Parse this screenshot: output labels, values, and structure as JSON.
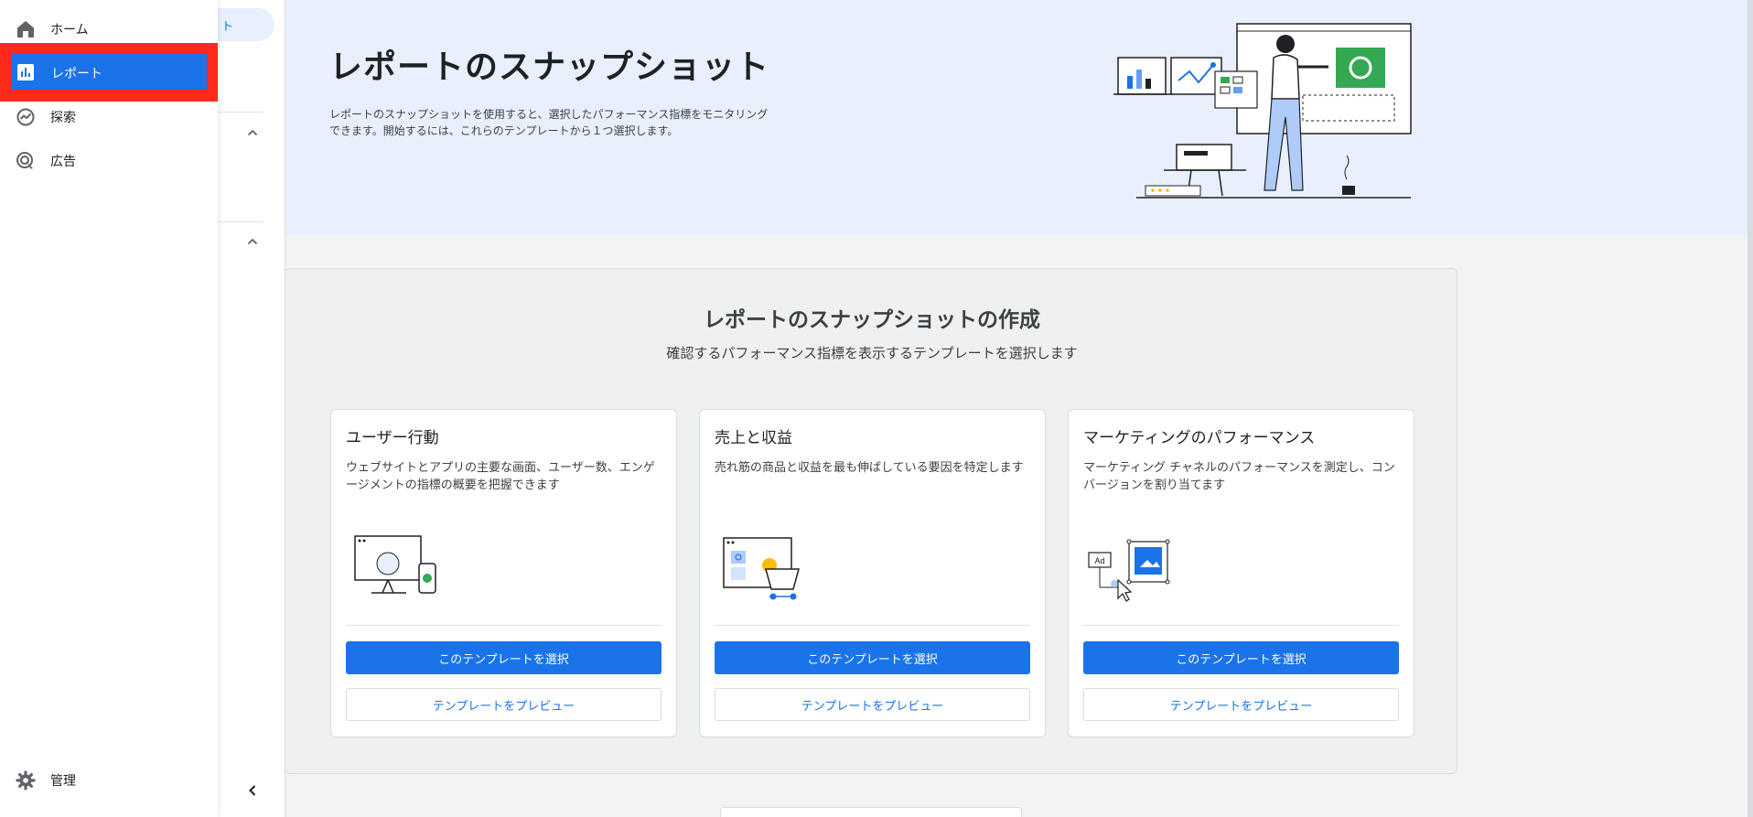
{
  "nav": {
    "items": [
      {
        "label": "ホーム",
        "icon": "home-icon"
      },
      {
        "label": "レポート",
        "icon": "bar-chart-icon",
        "active": true
      },
      {
        "label": "探索",
        "icon": "explore-icon"
      },
      {
        "label": "広告",
        "icon": "advertising-icon"
      }
    ],
    "admin": {
      "label": "管理",
      "icon": "gear-icon"
    }
  },
  "subnav": {
    "pill_label": "ト"
  },
  "hero": {
    "title": "レポートのスナップショット",
    "description": "レポートのスナップショットを使用すると、選択したパフォーマンス指標をモニタリングできます。開始するには、これらのテンプレートから１つ選択します。"
  },
  "panel": {
    "title": "レポートのスナップショットの作成",
    "subtitle": "確認するパフォーマンス指標を表示するテンプレートを選択します",
    "cards": [
      {
        "title": "ユーザー行動",
        "description": "ウェブサイトとアプリの主要な画面、ユーザー数、エンゲージメントの指標の概要を把握できます",
        "illustration": "monitor-phone-illustration",
        "select_label": "このテンプレートを選択",
        "preview_label": "テンプレートをプレビュー"
      },
      {
        "title": "売上と収益",
        "description": "売れ筋の商品と収益を最も伸ばしている要因を特定します",
        "illustration": "shopping-cart-illustration",
        "select_label": "このテンプレートを選択",
        "preview_label": "テンプレートをプレビュー"
      },
      {
        "title": "マーケティングのパフォーマンス",
        "description": "マーケティング チャネルのパフォーマンスを測定し、コンバージョンを割り当てます",
        "illustration": "ad-click-illustration",
        "ad_label": "Ad",
        "select_label": "このテンプレートを選択",
        "preview_label": "テンプレートをプレビュー"
      }
    ]
  },
  "colors": {
    "accent": "#1a73e8",
    "highlight": "#ff2a1a",
    "hero_bg": "#e8f0fe"
  }
}
